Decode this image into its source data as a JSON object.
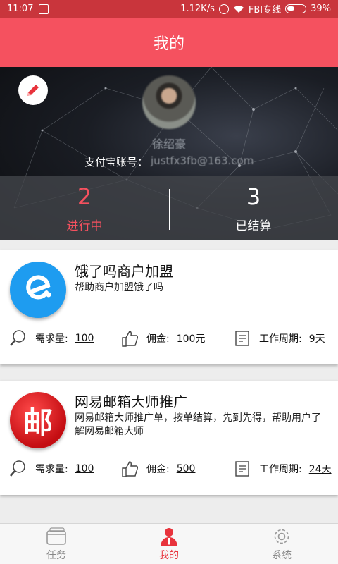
{
  "statusbar": {
    "time": "11:07",
    "speed": "1.12K/s",
    "carrier": "FBI专线",
    "battery": "39%"
  },
  "appbar": {
    "title": "我的"
  },
  "profile": {
    "username": "徐绍豪",
    "alipay_label": "支付宝账号：",
    "alipay_value": "justfx3fb@163.com",
    "stats": [
      {
        "count": "2",
        "label": "进行中"
      },
      {
        "count": "3",
        "label": "已结算"
      }
    ]
  },
  "tasks": [
    {
      "title": "饿了吗商户加盟",
      "desc": "帮助商户加盟饿了吗",
      "demand_label": "需求量:",
      "demand": "100",
      "commission_label": "佣金:",
      "commission": "100元",
      "period_label": "工作周期:",
      "period": "9天"
    },
    {
      "title": "网易邮箱大师推广",
      "desc": "网易邮箱大师推广单，按单结算，先到先得，帮助用户了解网易邮箱大师",
      "logo_text": "邮",
      "demand_label": "需求量:",
      "demand": "100",
      "commission_label": "佣金:",
      "commission": "500",
      "period_label": "工作周期:",
      "period": "24天"
    }
  ],
  "tabbar": {
    "items": [
      {
        "label": "任务",
        "icon": "wallet-icon"
      },
      {
        "label": "我的",
        "icon": "user-icon"
      },
      {
        "label": "系统",
        "icon": "gear-icon"
      }
    ],
    "active_color": "#e8333c"
  },
  "colors": {
    "appbar": "#f5515f",
    "accent": "#f5515f"
  }
}
